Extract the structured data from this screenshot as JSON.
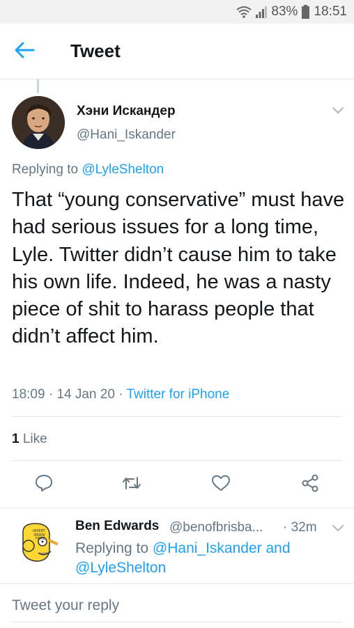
{
  "status": {
    "battery": "83%",
    "time": "18:51"
  },
  "header": {
    "title": "Tweet"
  },
  "tweet": {
    "author_name": "Хэни Искандер",
    "author_handle": "@Hani_Iskander",
    "replying_prefix": "Replying to",
    "replying_to": "@LyleShelton",
    "text": "That “young conservative” must have had serious issues for a long time, Lyle. Twitter didn’t cause him to take his own life. Indeed, he was a nasty piece of shit to harass people that didn’t affect him.",
    "time": "18:09",
    "date": "14 Jan 20",
    "source": "Twitter for iPhone",
    "like_count": "1",
    "like_label": "Like"
  },
  "reply": {
    "author_name": "Ben Edwards",
    "author_handle": "@benofbrisba...",
    "age": "· 32m",
    "replying_prefix": "Replying to",
    "replying_to_1": "@Hani_Iskander",
    "and": "and",
    "replying_to_2": "@LyleShelton"
  },
  "compose": {
    "placeholder": "Tweet your reply"
  },
  "colors": {
    "accent": "#1da1f2",
    "secondary_text": "#657786",
    "divider": "#e1e8ed"
  },
  "icons": [
    "wifi-icon",
    "signal-icon",
    "battery-icon",
    "back-arrow-icon",
    "chevron-down-icon",
    "reply-icon",
    "retweet-icon",
    "like-icon",
    "share-icon"
  ]
}
